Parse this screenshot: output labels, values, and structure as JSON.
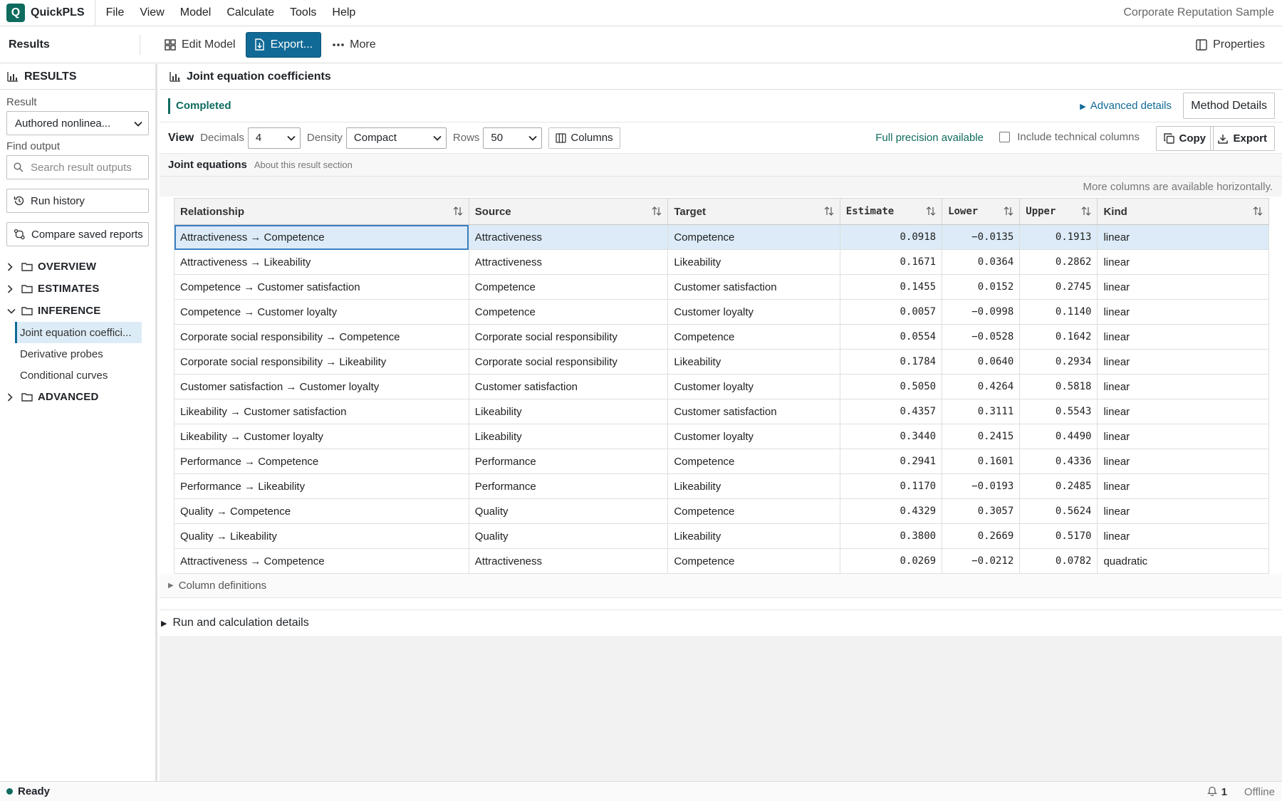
{
  "app": {
    "name": "QuickPLS",
    "logo_letter": "Q",
    "window_title": "Corporate Reputation Sample",
    "menu": [
      "File",
      "View",
      "Model",
      "Calculate",
      "Tools",
      "Help"
    ]
  },
  "toolbar": {
    "title": "Results",
    "edit_model": "Edit Model",
    "export": "Export...",
    "more": "More",
    "properties": "Properties"
  },
  "sidebar": {
    "heading": "RESULTS",
    "result_label": "Result",
    "result_value": "Authored nonlinea...",
    "find_label": "Find output",
    "search_placeholder": "Search result outputs",
    "run_history": "Run history",
    "compare_reports": "Compare saved reports",
    "folders": {
      "overview": "OVERVIEW",
      "estimates": "ESTIMATES",
      "inference": "INFERENCE",
      "advanced": "ADVANCED"
    },
    "inference_items": [
      "Joint equation coeffici...",
      "Derivative probes",
      "Conditional curves"
    ]
  },
  "main": {
    "panel_title": "Joint equation coefficients",
    "status": "Completed",
    "advanced_details": "Advanced details",
    "method_details": "Method Details",
    "view": {
      "label": "View",
      "decimals_label": "Decimals",
      "decimals_value": "4",
      "density_label": "Density",
      "density_value": "Compact",
      "rows_label": "Rows",
      "rows_value": "50",
      "columns_button": "Columns",
      "full_precision": "Full precision available",
      "include_technical": "Include technical columns",
      "copy": "Copy",
      "export": "Export"
    },
    "section_title": "Joint equations",
    "section_about": "About this result section",
    "more_columns_hint": "More columns are available horizontally.",
    "column_definitions": "Column definitions",
    "run_details": "Run and calculation details"
  },
  "table": {
    "headers": [
      "Relationship",
      "Source",
      "Target",
      "Estimate",
      "Lower",
      "Upper",
      "Kind"
    ],
    "rows": [
      [
        "Attractiveness → Competence",
        "Attractiveness",
        "Competence",
        "0.0918",
        "−0.0135",
        "0.1913",
        "linear"
      ],
      [
        "Attractiveness → Likeability",
        "Attractiveness",
        "Likeability",
        "0.1671",
        "0.0364",
        "0.2862",
        "linear"
      ],
      [
        "Competence → Customer satisfaction",
        "Competence",
        "Customer satisfaction",
        "0.1455",
        "0.0152",
        "0.2745",
        "linear"
      ],
      [
        "Competence → Customer loyalty",
        "Competence",
        "Customer loyalty",
        "0.0057",
        "−0.0998",
        "0.1140",
        "linear"
      ],
      [
        "Corporate social responsibility → Competence",
        "Corporate social responsibility",
        "Competence",
        "0.0554",
        "−0.0528",
        "0.1642",
        "linear"
      ],
      [
        "Corporate social responsibility → Likeability",
        "Corporate social responsibility",
        "Likeability",
        "0.1784",
        "0.0640",
        "0.2934",
        "linear"
      ],
      [
        "Customer satisfaction → Customer loyalty",
        "Customer satisfaction",
        "Customer loyalty",
        "0.5050",
        "0.4264",
        "0.5818",
        "linear"
      ],
      [
        "Likeability → Customer satisfaction",
        "Likeability",
        "Customer satisfaction",
        "0.4357",
        "0.3111",
        "0.5543",
        "linear"
      ],
      [
        "Likeability → Customer loyalty",
        "Likeability",
        "Customer loyalty",
        "0.3440",
        "0.2415",
        "0.4490",
        "linear"
      ],
      [
        "Performance → Competence",
        "Performance",
        "Competence",
        "0.2941",
        "0.1601",
        "0.4336",
        "linear"
      ],
      [
        "Performance → Likeability",
        "Performance",
        "Likeability",
        "0.1170",
        "−0.0193",
        "0.2485",
        "linear"
      ],
      [
        "Quality → Competence",
        "Quality",
        "Competence",
        "0.4329",
        "0.3057",
        "0.5624",
        "linear"
      ],
      [
        "Quality → Likeability",
        "Quality",
        "Likeability",
        "0.3800",
        "0.2669",
        "0.5170",
        "linear"
      ],
      [
        "Attractiveness → Competence",
        "Attractiveness",
        "Competence",
        "0.0269",
        "−0.0212",
        "0.0782",
        "quadratic"
      ]
    ]
  },
  "statusbar": {
    "status": "Ready",
    "notifications": "1",
    "connection": "Offline"
  },
  "colors": {
    "brand": "#0e6b5e",
    "primary": "#116a96",
    "selection": "#dcebf7"
  }
}
